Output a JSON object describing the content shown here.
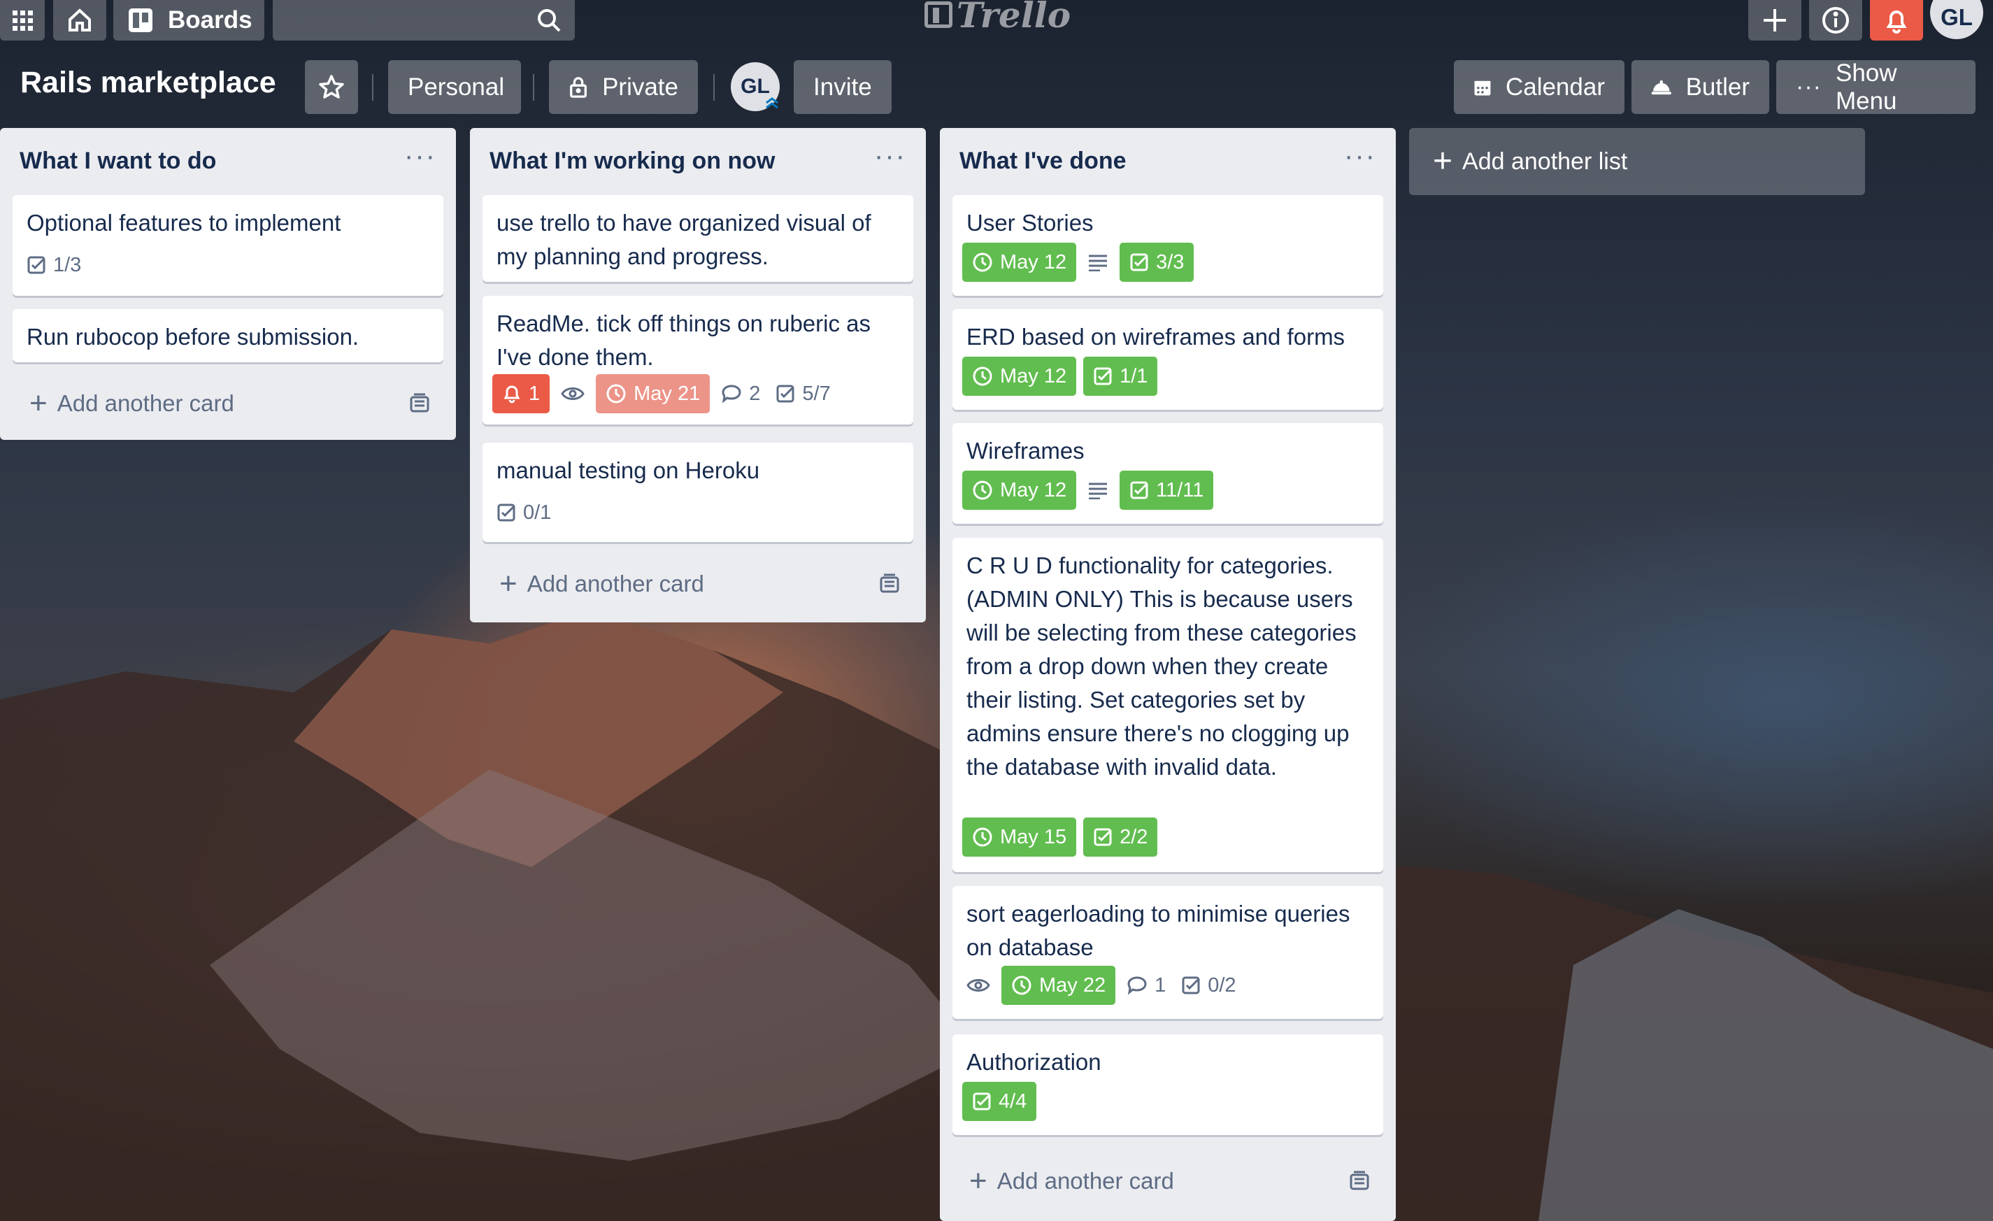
{
  "topbar": {
    "boards_label": "Boards",
    "logo_text": "Trello",
    "avatar_initials": "GL"
  },
  "board": {
    "title": "Rails marketplace",
    "personal_label": "Personal",
    "private_label": "Private",
    "member_initials": "GL",
    "invite_label": "Invite",
    "calendar_label": "Calendar",
    "butler_label": "Butler",
    "show_menu_label": "Show Menu"
  },
  "lists": [
    {
      "title": "What I want to do",
      "add_card_label": "Add another card",
      "cards": [
        {
          "title": "Optional features to implement",
          "checklist": "1/3"
        },
        {
          "title": "Run rubocop before submission."
        }
      ]
    },
    {
      "title": "What I'm working on now",
      "add_card_label": "Add another card",
      "cards": [
        {
          "title": "use trello to have organized visual of my planning and progress."
        },
        {
          "title": "ReadMe. tick off things on ruberic as I've done them.",
          "notifications": "1",
          "due": "May 21",
          "comments": "2",
          "checklist": "5/7"
        },
        {
          "title": "manual testing on Heroku",
          "checklist": "0/1"
        }
      ]
    },
    {
      "title": "What I've done",
      "add_card_label": "Add another card",
      "cards": [
        {
          "title": "User Stories",
          "due": "May 12",
          "checklist": "3/3"
        },
        {
          "title": "ERD based on wireframes and forms",
          "due": "May 12",
          "checklist": "1/1"
        },
        {
          "title": "Wireframes",
          "due": "May 12",
          "checklist": "11/11"
        },
        {
          "title": "C R U D functionality for categories. (ADMIN ONLY) This is because users will be selecting from these categories from a drop down when they create their listing. Set categories set by admins ensure there's no clogging up the database with invalid data.",
          "due": "May 15",
          "checklist": "2/2"
        },
        {
          "title": "sort eagerloading to minimise queries on database",
          "due": "May 22",
          "comments": "1",
          "checklist": "0/2"
        },
        {
          "title": "Authorization",
          "checklist": "4/4"
        }
      ]
    }
  ],
  "add_list_label": "Add another list",
  "colors": {
    "green_label": "#61bd4f",
    "red_label": "#eb5a46",
    "overdue_label": "#ec9488",
    "list_bg": "#ebecf0"
  }
}
